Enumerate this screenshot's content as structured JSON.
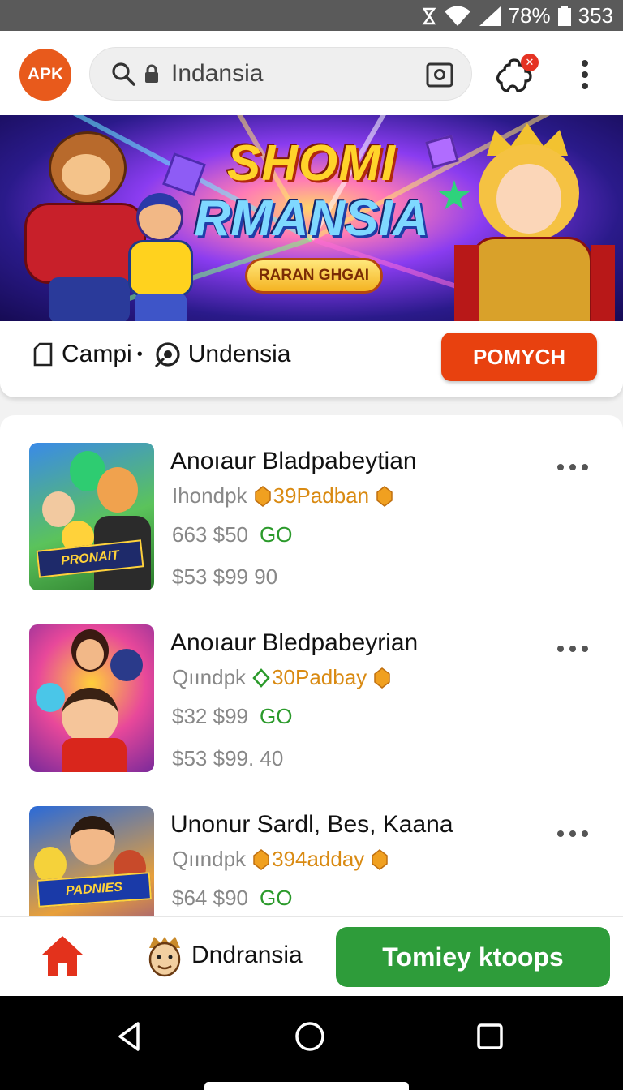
{
  "status_bar": {
    "battery": "78%",
    "time": "353"
  },
  "app_bar": {
    "logo_text": "APK",
    "search_text": "Indansia",
    "notification_badge": "✕"
  },
  "banner": {
    "title_line1": "SHOMI",
    "title_line2": "RMANSIA",
    "pill": "RARAN GHGAI"
  },
  "info": {
    "category": "Campi",
    "region": "Undensia",
    "button": "POMYCH"
  },
  "items": [
    {
      "title": "Anoıaur Bladpabeytian",
      "meta_prefix": "Ihondpk",
      "meta_gold": "39Padban",
      "price1": "663  $50",
      "badge": "GO",
      "price2": "$53  $99  90",
      "thumb_label": "PRONAIT"
    },
    {
      "title": "Anoıaur Bledpabeyrian",
      "meta_prefix": "Qıındpk",
      "meta_gold": "30Padbay",
      "price1": "$32  $99",
      "badge": "GO",
      "price2": "$53  $99. 40",
      "thumb_label": ""
    },
    {
      "title": "Unonur  Sardl, Bes, Kaana",
      "meta_prefix": "Qıındpk",
      "meta_gold": "394adday",
      "price1": "$64  $90",
      "badge": "GO",
      "price2": "",
      "thumb_label": "PADNIES"
    }
  ],
  "bottom_nav": {
    "label": "Dndransia",
    "cta": "Tomiey ktoops"
  },
  "colors": {
    "accent_orange": "#e8410f",
    "cta_green": "#2e9c3a",
    "gold": "#d98a12",
    "go_green": "#2b9a2b"
  }
}
